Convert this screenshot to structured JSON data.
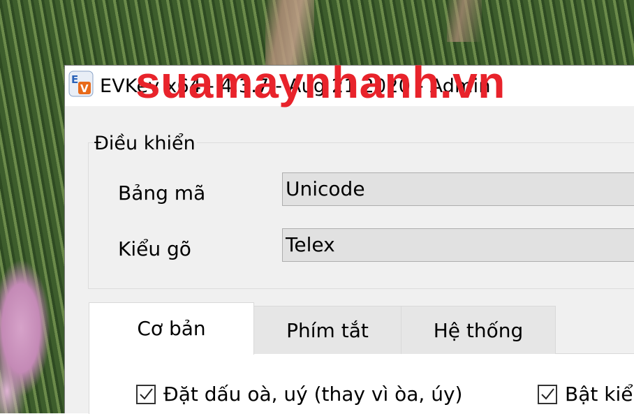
{
  "window": {
    "title": "EVKey x64 - 4.3.7 - Aug 21 2020 - Admin",
    "icon": "evkey-app-icon"
  },
  "watermark": "suamaynhanh.vn",
  "control_group": {
    "label": "Điều khiển",
    "charset_label": "Bảng mã",
    "charset_value": "Unicode",
    "input_method_label": "Kiểu gõ",
    "input_method_value": "Telex"
  },
  "tabs": [
    {
      "label": "Cơ bản",
      "active": true
    },
    {
      "label": "Phím tắt",
      "active": false
    },
    {
      "label": "Hệ thống",
      "active": false
    }
  ],
  "options": [
    {
      "label": "Đặt dấu oà, uý (thay vì òa, úy)",
      "checked": true
    },
    {
      "label": "Bật kiể",
      "checked": true
    }
  ],
  "colors": {
    "watermark": "#e8232b",
    "window_bg": "#f0f0f0"
  }
}
